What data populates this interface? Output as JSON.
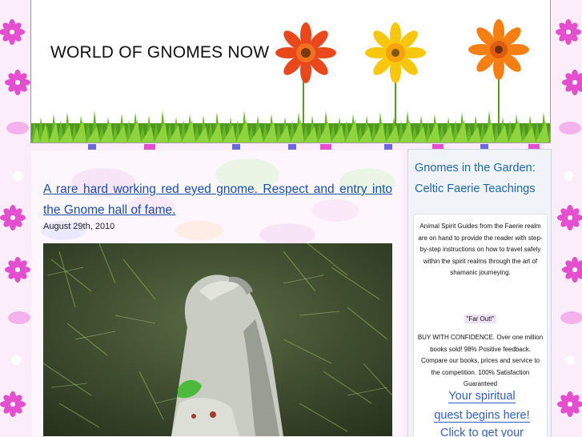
{
  "site": {
    "title": "WORLD OF GNOMES NOW"
  },
  "post": {
    "title": "A rare hard working red eyed gnome. Respect and entry into the Gnome hall of fame.",
    "date": "August 29th, 2010"
  },
  "sidebar": {
    "title": "Gnomes in the Garden: Celtic Faerie Teachings",
    "description": "Animal Spirit Guides from the Faerie realm are on hand to provide the reader with step-by-step instructions on how to travel safely within the spirit realms through the art of shamanic journeying.",
    "tagline": "\"Far Out!\"",
    "guarantee": "BUY WITH CONFIDENCE. Over one million books sold! 98% Positive feedback. Compare our books, prices and service to the competition. 100% Satisfaction Guaranteed",
    "link_line1": "Your spiritual",
    "link_line2": "quest begins here!",
    "link_line3": "Click to get your"
  },
  "colors": {
    "link": "#1a4fa8",
    "sidebar_title": "#1a67b0",
    "flower_pink": "#e040c8",
    "flower_blue": "#4a4ad8"
  }
}
